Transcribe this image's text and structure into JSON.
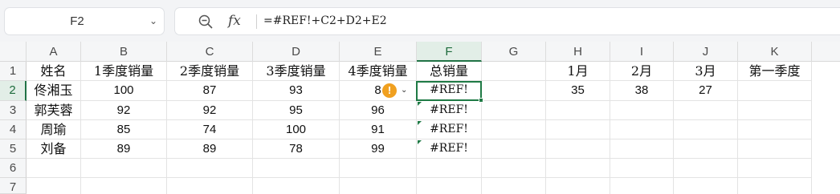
{
  "formula_bar": {
    "name_box": "F2",
    "name_box_caret": "⌄",
    "fx_label": "fx",
    "formula": "=#REF!+C2+D2+E2"
  },
  "columns": [
    "A",
    "B",
    "C",
    "D",
    "E",
    "F",
    "G",
    "H",
    "I",
    "J",
    "K"
  ],
  "rows": [
    "1",
    "2",
    "3",
    "4",
    "5",
    "6",
    "7"
  ],
  "cells": {
    "A1": "姓名",
    "B1": "1季度销量",
    "C1": "2季度销量",
    "D1": "3季度销量",
    "E1": "4季度销量",
    "F1": "总销量",
    "H1": "1月",
    "I1": "2月",
    "J1": "3月",
    "K1": "第一季度",
    "A2": "佟湘玉",
    "B2": "100",
    "C2": "87",
    "D2": "93",
    "E2": "8",
    "F2": "#REF!",
    "H2": "35",
    "I2": "38",
    "J2": "27",
    "A3": "郭芙蓉",
    "B3": "92",
    "C3": "92",
    "D3": "95",
    "E3": "96",
    "F3": "#REF!",
    "A4": "周瑜",
    "B4": "85",
    "C4": "74",
    "D4": "100",
    "E4": "91",
    "F4": "#REF!",
    "A5": "刘备",
    "B5": "89",
    "C5": "89",
    "D5": "78",
    "E5": "99",
    "F5": "#REF!"
  },
  "error_indicator": {
    "symbol": "!",
    "caret": "⌄"
  },
  "colors": {
    "accent": "#217346",
    "warning": "#f0a020"
  }
}
